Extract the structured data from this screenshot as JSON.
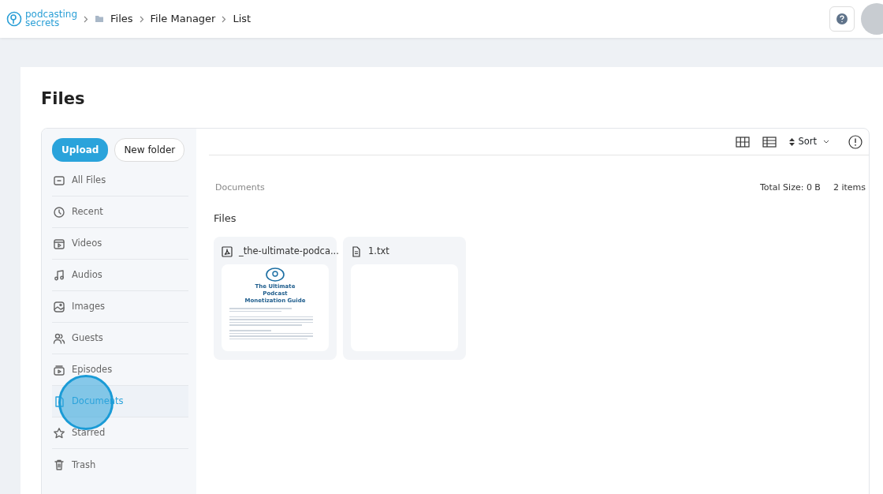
{
  "logo": {
    "line1": "podcasting",
    "line2": "secrets"
  },
  "breadcrumbs": [
    {
      "label": "Files",
      "icon": true
    },
    {
      "label": "File Manager",
      "icon": false
    },
    {
      "label": "List",
      "icon": false
    }
  ],
  "page_title": "Files",
  "actions": [
    "Upload",
    "New folder"
  ],
  "sidebar": [
    {
      "label": "All Files",
      "selected": false
    },
    {
      "label": "Recent",
      "selected": false
    },
    {
      "label": "Videos",
      "selected": false
    },
    {
      "label": "Audios",
      "selected": false
    },
    {
      "label": "Images",
      "selected": false
    },
    {
      "label": "Guests",
      "selected": false
    },
    {
      "label": "Episodes",
      "selected": false
    },
    {
      "label": "Documents",
      "selected": true
    },
    {
      "label": "Starred",
      "selected": false
    },
    {
      "label": "Trash",
      "selected": false
    }
  ],
  "toolbar": {
    "sort": "Sort"
  },
  "location": "Documents",
  "total_size": "Total Size: 0 B",
  "item_count": "2 items",
  "section_title": "Files",
  "files": [
    {
      "name": "_the-ultimate-podca...",
      "kind": "pdf",
      "preview_title": "The Ultimate Podcast Monetization Guide"
    },
    {
      "name": "1.txt",
      "kind": "txt"
    }
  ]
}
